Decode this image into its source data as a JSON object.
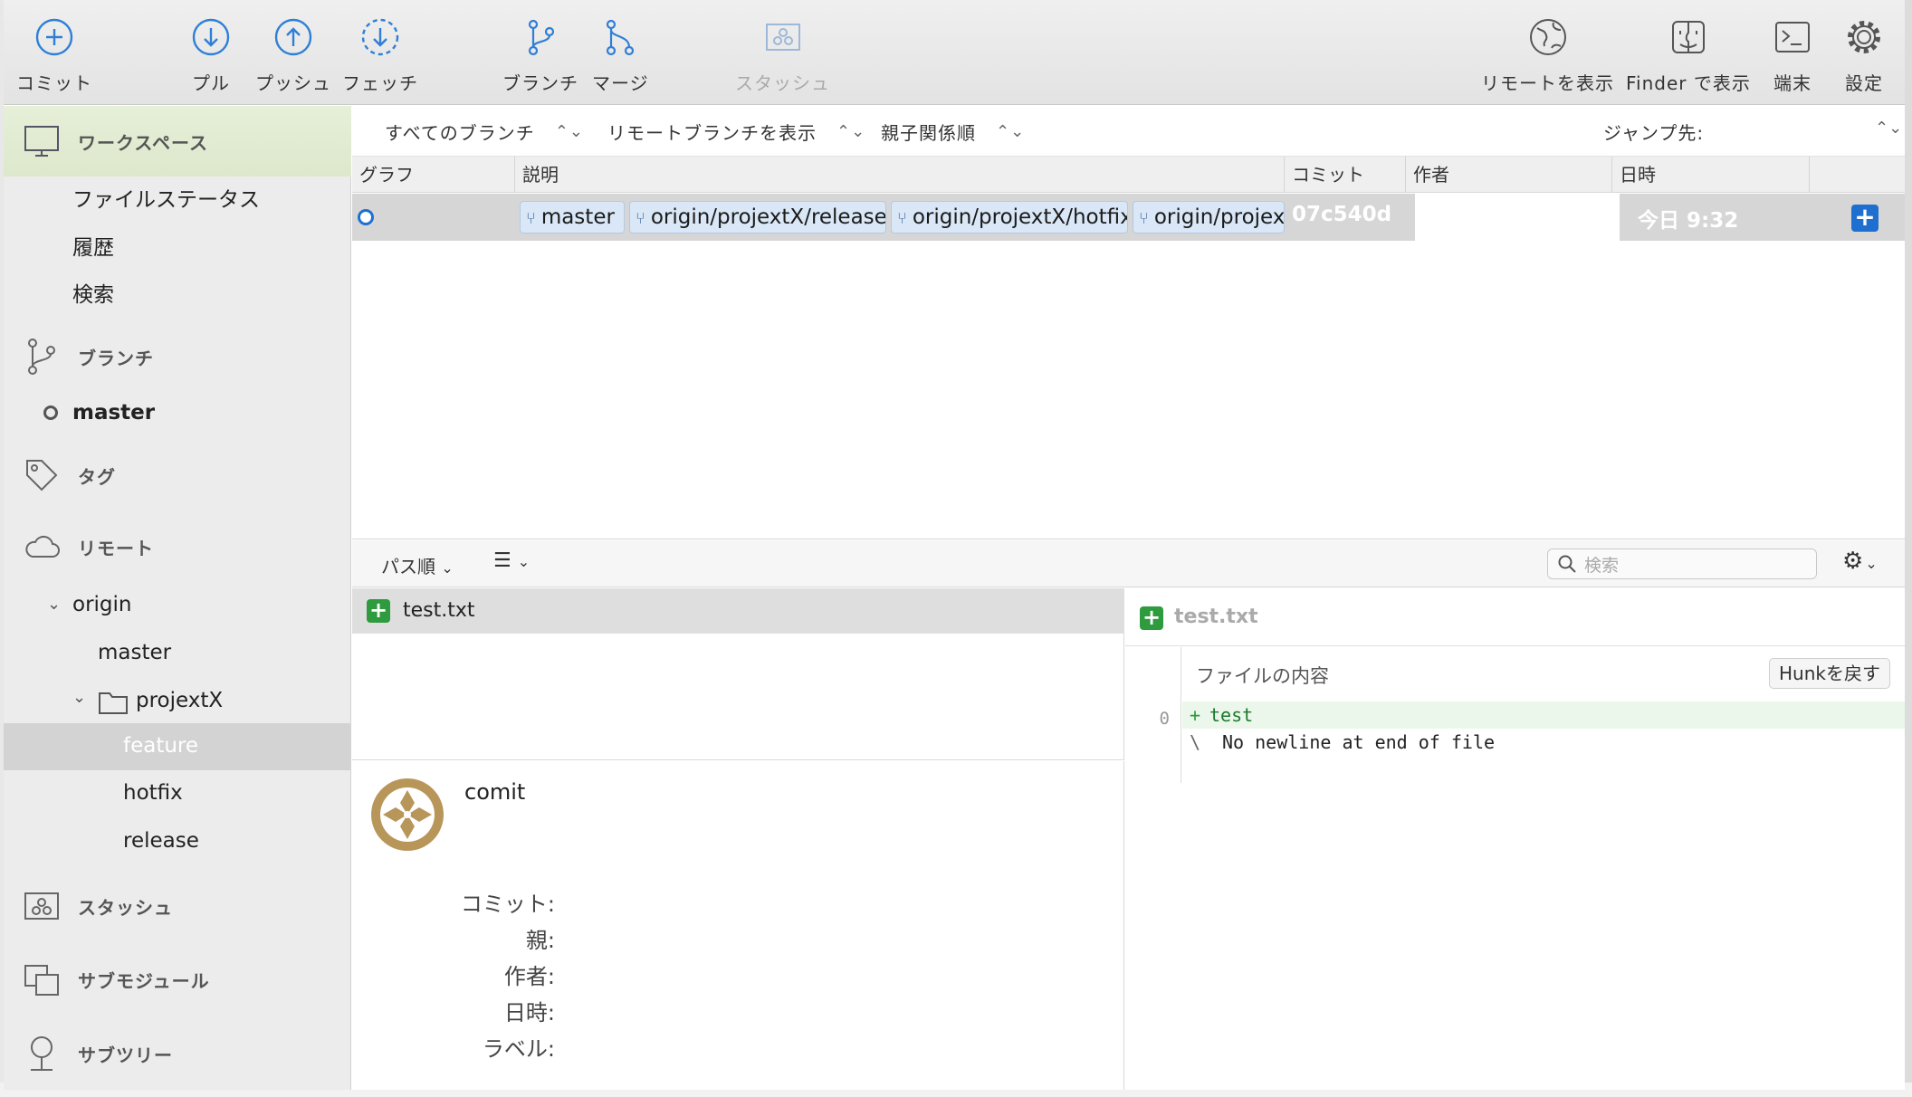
{
  "toolbar": {
    "commit": "コミット",
    "pull": "プル",
    "push": "プッシュ",
    "fetch": "フェッチ",
    "branch": "ブランチ",
    "merge": "マージ",
    "stash": "スタッシュ",
    "show_remote": "リモートを表示",
    "show_finder": "Finder で表示",
    "terminal": "端末",
    "settings": "設定"
  },
  "sidebar": {
    "workspace": "ワークスペース",
    "workspace_items": [
      "ファイルステータス",
      "履歴",
      "検索"
    ],
    "branches": "ブランチ",
    "current_branch": "master",
    "tags": "タグ",
    "remotes": "リモート",
    "remote_name": "origin",
    "remote_master": "master",
    "folder": "projextX",
    "folder_items": [
      "feature",
      "hotfix",
      "release"
    ],
    "stash": "スタッシュ",
    "submodules": "サブモジュール",
    "subtrees": "サブツリー"
  },
  "filters": {
    "branches": "すべてのブランチ",
    "remote": "リモートブランチを表示",
    "order": "親子関係順",
    "jump": "ジャンプ先:"
  },
  "columns": {
    "graph": "グラフ",
    "description": "説明",
    "commit": "コミット",
    "author": "作者",
    "date": "日時"
  },
  "commit_row": {
    "refs": [
      "master",
      "origin/projextX/release",
      "origin/projextX/hotfix",
      "origin/projextX"
    ],
    "hash": "07c540d",
    "date": "今日 9:32"
  },
  "filebar": {
    "sort": "パス順",
    "search_placeholder": "検索"
  },
  "files": {
    "name": "test.txt"
  },
  "details": {
    "message": "comit",
    "labels": [
      "コミット:",
      "親:",
      "作者:",
      "日時:",
      "ラベル:"
    ]
  },
  "diff": {
    "file": "test.txt",
    "hunk_title": "ファイルの内容",
    "revert_hunk": "Hunkを戻す",
    "line_number": "0",
    "added_marker": "+",
    "added_text": "test",
    "nonewline_marker": "\\",
    "nonewline_text": "No newline at end of file"
  },
  "colors": {
    "accent": "#1f6fd1",
    "added": "#2e9b3e",
    "ref_bg": "#d9e7f7"
  }
}
